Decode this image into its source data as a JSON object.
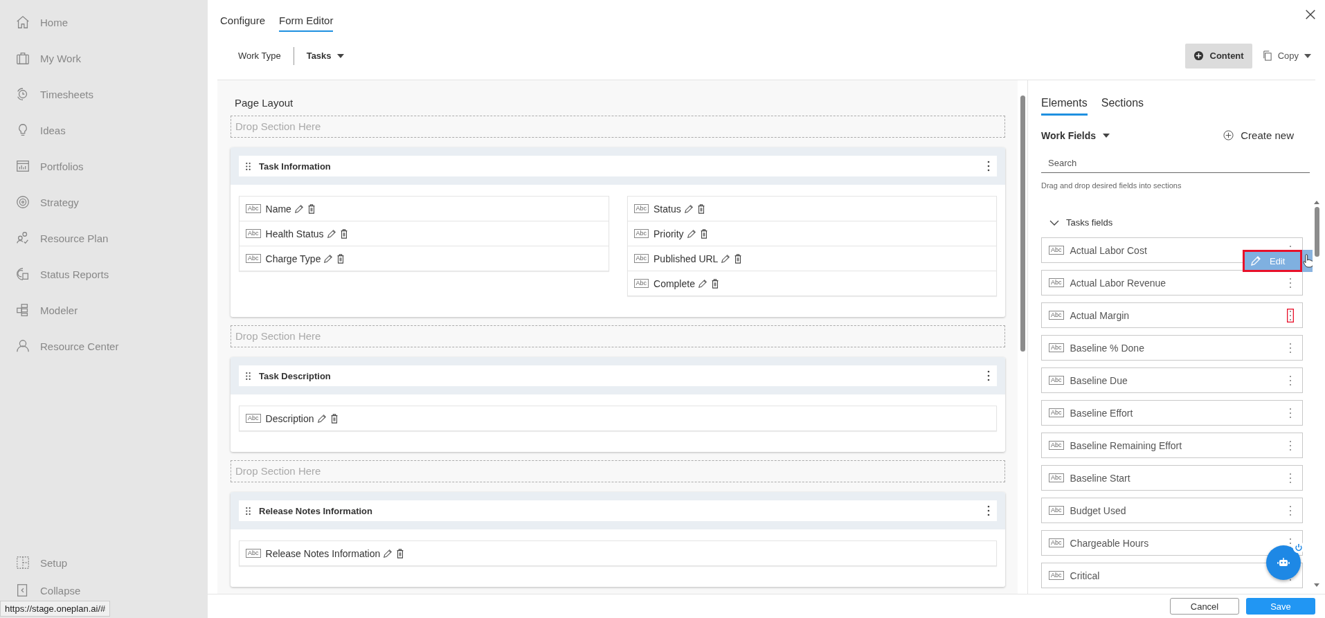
{
  "sidebar": {
    "items": [
      {
        "label": "Home"
      },
      {
        "label": "My Work"
      },
      {
        "label": "Timesheets"
      },
      {
        "label": "Ideas"
      },
      {
        "label": "Portfolios"
      },
      {
        "label": "Strategy"
      },
      {
        "label": "Resource Plan"
      },
      {
        "label": "Status Reports"
      },
      {
        "label": "Modeler"
      },
      {
        "label": "Resource Center"
      }
    ],
    "bottom_items": [
      {
        "label": "Setup"
      },
      {
        "label": "Collapse"
      }
    ]
  },
  "header": {
    "tabs": [
      {
        "label": "Configure",
        "selected": false
      },
      {
        "label": "Form Editor",
        "selected": true
      }
    ]
  },
  "toolbar": {
    "work_type_label": "Work Type",
    "work_type_value": "Tasks",
    "content_button": "Content",
    "copy_button": "Copy"
  },
  "page_layout": {
    "title": "Page Layout",
    "blocks": [
      {
        "kind": "drop_zone",
        "text": "Drop Section Here"
      },
      {
        "kind": "section",
        "title": "Task Information",
        "columns": [
          [
            {
              "type_badge": "Abc",
              "label": "Name"
            },
            {
              "type_badge": "Abc",
              "label": "Health Status"
            },
            {
              "type_badge": "Abc",
              "label": "Charge Type"
            }
          ],
          [
            {
              "type_badge": "Abc",
              "label": "Status"
            },
            {
              "type_badge": "Abc",
              "label": "Priority"
            },
            {
              "type_badge": "Abc",
              "label": "Published URL"
            },
            {
              "type_badge": "Abc",
              "label": "Complete"
            }
          ]
        ]
      },
      {
        "kind": "drop_zone",
        "text": "Drop Section Here"
      },
      {
        "kind": "section",
        "title": "Task Description",
        "columns": [
          [
            {
              "type_badge": "Abc",
              "label": "Description"
            }
          ]
        ]
      },
      {
        "kind": "drop_zone",
        "text": "Drop Section Here"
      },
      {
        "kind": "section",
        "title": "Release Notes Information",
        "columns": [
          [
            {
              "type_badge": "Abc",
              "label": "Release Notes Information"
            }
          ]
        ]
      }
    ]
  },
  "right_panel": {
    "tabs": [
      {
        "label": "Elements",
        "selected": true
      },
      {
        "label": "Sections",
        "selected": false
      }
    ],
    "field_source": "Work Fields",
    "create_new": "Create new",
    "search": {
      "placeholder": "Search"
    },
    "hint": "Drag and drop desired fields into sections",
    "group": {
      "label": "Tasks fields",
      "expanded": true
    },
    "fields": [
      {
        "type_badge": "Abc",
        "label": "Actual Labor Cost",
        "menu_highlighted": false,
        "context_menu": {
          "label": "Edit",
          "highlighted": true
        }
      },
      {
        "type_badge": "Abc",
        "label": "Actual Labor Revenue",
        "menu_highlighted": false
      },
      {
        "type_badge": "Abc",
        "label": "Actual Margin",
        "menu_highlighted": true
      },
      {
        "type_badge": "Abc",
        "label": "Baseline % Done",
        "menu_highlighted": false
      },
      {
        "type_badge": "Abc",
        "label": "Baseline Due",
        "menu_highlighted": false
      },
      {
        "type_badge": "Abc",
        "label": "Baseline Effort",
        "menu_highlighted": false
      },
      {
        "type_badge": "Abc",
        "label": "Baseline Remaining Effort",
        "menu_highlighted": false
      },
      {
        "type_badge": "Abc",
        "label": "Baseline Start",
        "menu_highlighted": false
      },
      {
        "type_badge": "Abc",
        "label": "Budget Used",
        "menu_highlighted": false
      },
      {
        "type_badge": "Abc",
        "label": "Chargeable Hours",
        "menu_highlighted": false
      },
      {
        "type_badge": "Abc",
        "label": "Critical",
        "menu_highlighted": false
      }
    ]
  },
  "footer": {
    "cancel": "Cancel",
    "save": "Save"
  },
  "status_url": "https://stage.oneplan.ai/#"
}
